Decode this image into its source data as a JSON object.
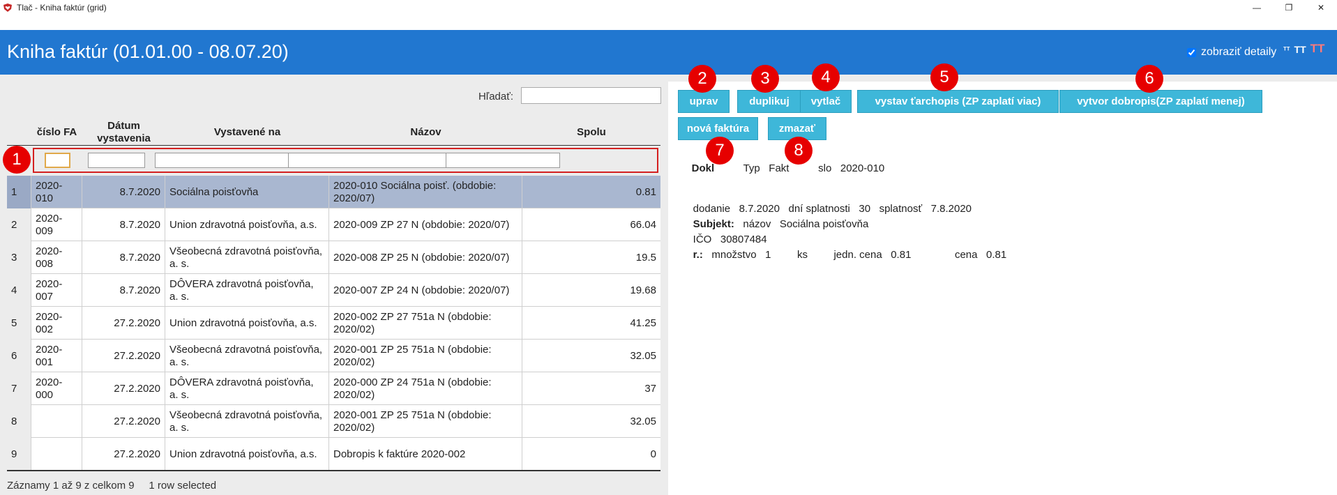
{
  "window": {
    "title": "Tlač - Kniha faktúr (grid)",
    "app_icon": "heart-shield-icon"
  },
  "header": {
    "title": "Kniha faktúr (01.01.00 - 08.07.20)",
    "details_label": "zobraziť detaily",
    "details_checked": true,
    "font_tools": [
      "font-small-icon",
      "font-medium-icon",
      "font-large-icon"
    ]
  },
  "search": {
    "label": "Hľadať:",
    "value": ""
  },
  "grid": {
    "columns": [
      "číslo FA",
      "Dátum vystavenia",
      "Vystavené na",
      "Názov",
      "Spolu"
    ],
    "rows": [
      {
        "n": "1",
        "cislo": "2020-010",
        "datum": "8.7.2020",
        "vystavene": "Sociálna poisťovňa",
        "nazov": "2020-010 Sociálna poisť. (obdobie: 2020/07)",
        "spolu": "0.81"
      },
      {
        "n": "2",
        "cislo": "2020-009",
        "datum": "8.7.2020",
        "vystavene": "Union zdravotná poisťovňa, a.s.",
        "nazov": "2020-009 ZP 27 N (obdobie: 2020/07)",
        "spolu": "66.04"
      },
      {
        "n": "3",
        "cislo": "2020-008",
        "datum": "8.7.2020",
        "vystavene": "Všeobecná zdravotná poisťovňa, a. s.",
        "nazov": "2020-008 ZP 25 N (obdobie: 2020/07)",
        "spolu": "19.5"
      },
      {
        "n": "4",
        "cislo": "2020-007",
        "datum": "8.7.2020",
        "vystavene": "DÔVERA zdravotná poisťovňa, a. s.",
        "nazov": "2020-007 ZP 24 N (obdobie: 2020/07)",
        "spolu": "19.68"
      },
      {
        "n": "5",
        "cislo": "2020-002",
        "datum": "27.2.2020",
        "vystavene": "Union zdravotná poisťovňa, a.s.",
        "nazov": "2020-002 ZP 27 751a N (obdobie: 2020/02)",
        "spolu": "41.25"
      },
      {
        "n": "6",
        "cislo": "2020-001",
        "datum": "27.2.2020",
        "vystavene": "Všeobecná zdravotná poisťovňa, a. s.",
        "nazov": "2020-001 ZP 25 751a N (obdobie: 2020/02)",
        "spolu": "32.05"
      },
      {
        "n": "7",
        "cislo": "2020-000",
        "datum": "27.2.2020",
        "vystavene": "DÔVERA zdravotná poisťovňa, a. s.",
        "nazov": "2020-000 ZP 24 751a N (obdobie: 2020/02)",
        "spolu": "37"
      },
      {
        "n": "8",
        "cislo": "",
        "datum": "27.2.2020",
        "vystavene": "Všeobecná zdravotná poisťovňa, a. s.",
        "nazov": "2020-001 ZP 25 751a N (obdobie: 2020/02)",
        "spolu": "32.05"
      },
      {
        "n": "9",
        "cislo": "",
        "datum": "27.2.2020",
        "vystavene": "Union zdravotná poisťovňa, a.s.",
        "nazov": "Dobropis k faktúre 2020-002",
        "spolu": "0"
      }
    ],
    "selected_row": 1,
    "status": "Záznamy 1 až 9 z celkom 9",
    "selection_status": "1 row selected"
  },
  "actions": {
    "uprav": "uprav",
    "duplikuj": "duplikuj",
    "vytlac": "vytlač",
    "tarchopis": "vystav ťarchopis (ZP zaplatí viac)",
    "dobropis": "vytvor dobropis(ZP zaplatí menej)",
    "nova": "nová faktúra",
    "zmazat": "zmazať"
  },
  "detail": {
    "doklad_label": "Dokl",
    "typ_label": "Typ",
    "typ_value": "Fakt",
    "cislo_label": "slo",
    "cislo_value": "2020-010",
    "dodanie_label": "dodanie",
    "dodanie_value": "8.7.2020",
    "splatnost_dni_label": "dní splatnosti",
    "splatnost_dni_value": "30",
    "splatnost_label": "splatnosť",
    "splatnost_value": "7.8.2020",
    "subjekt_label": "Subjekt:",
    "nazov_label": "názov",
    "nazov_value": "Sociálna poisťovňa",
    "ico_label": "IČO",
    "ico_value": "30807484",
    "r_label": "r.:",
    "mnozstvo_label": "množstvo",
    "mnozstvo_value": "1",
    "jednotka": "ks",
    "jedn_cena_label": "jedn. cena",
    "jedn_cena_value": "0.81",
    "cena_label": "cena",
    "cena_value": "0.81"
  },
  "callouts": [
    "1",
    "2",
    "3",
    "4",
    "5",
    "6",
    "7",
    "8"
  ],
  "colors": {
    "header": "#2177d0",
    "button": "#3eb7d9",
    "selected_row": "#a9b7d0",
    "callout": "#e60000"
  }
}
